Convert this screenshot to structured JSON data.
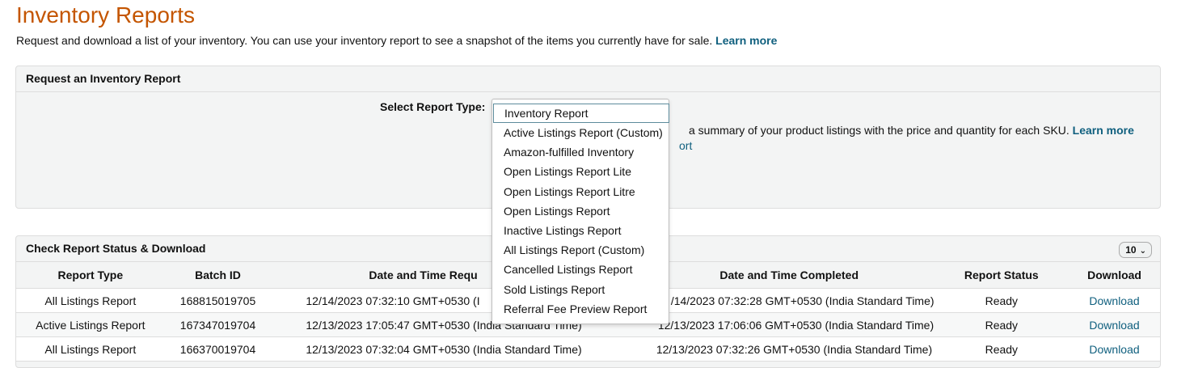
{
  "header": {
    "title": "Inventory Reports",
    "subtitle": "Request and download a list of your inventory. You can use your inventory report to see a snapshot of the items you currently have for sale.",
    "learn_more": "Learn more"
  },
  "request_panel": {
    "title": "Request an Inventory Report",
    "select_label": "Select Report Type:",
    "description_visible": "a summary of your product listings with the price and quantity for each SKU.",
    "learn_more": "Learn more",
    "partial_link": "ort"
  },
  "dropdown": {
    "selected": "Inventory Report",
    "options": [
      "Inventory Report",
      "Active Listings Report (Custom)",
      "Amazon-fulfilled Inventory",
      "Open Listings Report Lite",
      "Open Listings Report Litre",
      "Open Listings Report",
      "Inactive Listings Report",
      "All Listings Report (Custom)",
      "Cancelled Listings Report",
      "Sold Listings Report",
      "Referral Fee Preview Report"
    ]
  },
  "status_panel": {
    "title": "Check Report Status & Download",
    "page_size": "10",
    "columns": [
      "Report Type",
      "Batch ID",
      "Date and Time Requ",
      "Date and Time Completed",
      "Report Status",
      "Download"
    ],
    "rows": [
      {
        "type": "All Listings Report",
        "batch": "168815019705",
        "requested": "12/14/2023 07:32:10 GMT+0530 (I",
        "completed": "/14/2023 07:32:28 GMT+0530 (India Standard Time)",
        "status": "Ready",
        "download": "Download"
      },
      {
        "type": "Active Listings Report",
        "batch": "167347019704",
        "requested": "12/13/2023 17:05:47 GMT+0530 (India Standard Time)",
        "completed": "12/13/2023 17:06:06 GMT+0530 (India Standard Time)",
        "status": "Ready",
        "download": "Download"
      },
      {
        "type": "All Listings Report",
        "batch": "166370019704",
        "requested": "12/13/2023 07:32:04 GMT+0530 (India Standard Time)",
        "completed": "12/13/2023 07:32:26 GMT+0530 (India Standard Time)",
        "status": "Ready",
        "download": "Download"
      }
    ]
  },
  "colors": {
    "title": "#c45500",
    "link": "#0f5f7e",
    "panel_bg": "#f3f4f4"
  }
}
